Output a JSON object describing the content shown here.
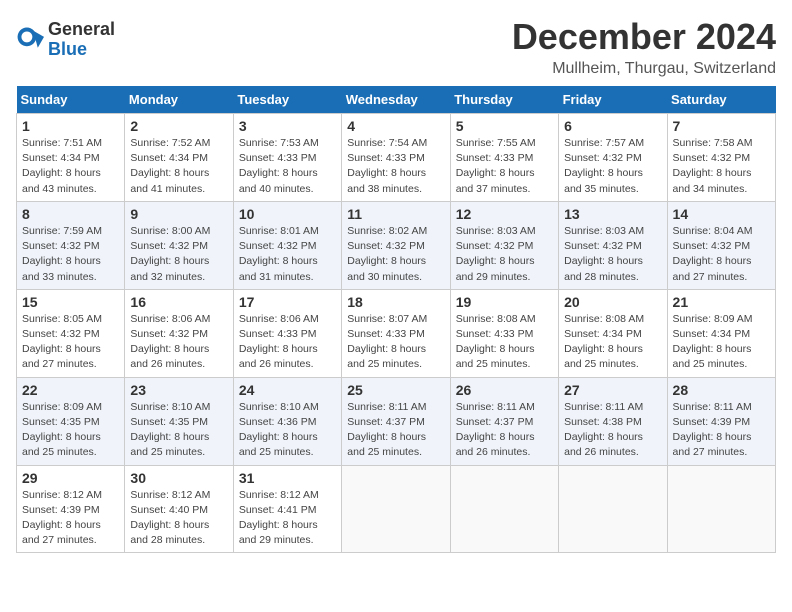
{
  "header": {
    "logo_line1": "General",
    "logo_line2": "Blue",
    "month": "December 2024",
    "location": "Mullheim, Thurgau, Switzerland"
  },
  "weekdays": [
    "Sunday",
    "Monday",
    "Tuesday",
    "Wednesday",
    "Thursday",
    "Friday",
    "Saturday"
  ],
  "weeks": [
    [
      {
        "day": "1",
        "sunrise": "7:51 AM",
        "sunset": "4:34 PM",
        "daylight": "8 hours and 43 minutes."
      },
      {
        "day": "2",
        "sunrise": "7:52 AM",
        "sunset": "4:34 PM",
        "daylight": "8 hours and 41 minutes."
      },
      {
        "day": "3",
        "sunrise": "7:53 AM",
        "sunset": "4:33 PM",
        "daylight": "8 hours and 40 minutes."
      },
      {
        "day": "4",
        "sunrise": "7:54 AM",
        "sunset": "4:33 PM",
        "daylight": "8 hours and 38 minutes."
      },
      {
        "day": "5",
        "sunrise": "7:55 AM",
        "sunset": "4:33 PM",
        "daylight": "8 hours and 37 minutes."
      },
      {
        "day": "6",
        "sunrise": "7:57 AM",
        "sunset": "4:32 PM",
        "daylight": "8 hours and 35 minutes."
      },
      {
        "day": "7",
        "sunrise": "7:58 AM",
        "sunset": "4:32 PM",
        "daylight": "8 hours and 34 minutes."
      }
    ],
    [
      {
        "day": "8",
        "sunrise": "7:59 AM",
        "sunset": "4:32 PM",
        "daylight": "8 hours and 33 minutes."
      },
      {
        "day": "9",
        "sunrise": "8:00 AM",
        "sunset": "4:32 PM",
        "daylight": "8 hours and 32 minutes."
      },
      {
        "day": "10",
        "sunrise": "8:01 AM",
        "sunset": "4:32 PM",
        "daylight": "8 hours and 31 minutes."
      },
      {
        "day": "11",
        "sunrise": "8:02 AM",
        "sunset": "4:32 PM",
        "daylight": "8 hours and 30 minutes."
      },
      {
        "day": "12",
        "sunrise": "8:03 AM",
        "sunset": "4:32 PM",
        "daylight": "8 hours and 29 minutes."
      },
      {
        "day": "13",
        "sunrise": "8:03 AM",
        "sunset": "4:32 PM",
        "daylight": "8 hours and 28 minutes."
      },
      {
        "day": "14",
        "sunrise": "8:04 AM",
        "sunset": "4:32 PM",
        "daylight": "8 hours and 27 minutes."
      }
    ],
    [
      {
        "day": "15",
        "sunrise": "8:05 AM",
        "sunset": "4:32 PM",
        "daylight": "8 hours and 27 minutes."
      },
      {
        "day": "16",
        "sunrise": "8:06 AM",
        "sunset": "4:32 PM",
        "daylight": "8 hours and 26 minutes."
      },
      {
        "day": "17",
        "sunrise": "8:06 AM",
        "sunset": "4:33 PM",
        "daylight": "8 hours and 26 minutes."
      },
      {
        "day": "18",
        "sunrise": "8:07 AM",
        "sunset": "4:33 PM",
        "daylight": "8 hours and 25 minutes."
      },
      {
        "day": "19",
        "sunrise": "8:08 AM",
        "sunset": "4:33 PM",
        "daylight": "8 hours and 25 minutes."
      },
      {
        "day": "20",
        "sunrise": "8:08 AM",
        "sunset": "4:34 PM",
        "daylight": "8 hours and 25 minutes."
      },
      {
        "day": "21",
        "sunrise": "8:09 AM",
        "sunset": "4:34 PM",
        "daylight": "8 hours and 25 minutes."
      }
    ],
    [
      {
        "day": "22",
        "sunrise": "8:09 AM",
        "sunset": "4:35 PM",
        "daylight": "8 hours and 25 minutes."
      },
      {
        "day": "23",
        "sunrise": "8:10 AM",
        "sunset": "4:35 PM",
        "daylight": "8 hours and 25 minutes."
      },
      {
        "day": "24",
        "sunrise": "8:10 AM",
        "sunset": "4:36 PM",
        "daylight": "8 hours and 25 minutes."
      },
      {
        "day": "25",
        "sunrise": "8:11 AM",
        "sunset": "4:37 PM",
        "daylight": "8 hours and 25 minutes."
      },
      {
        "day": "26",
        "sunrise": "8:11 AM",
        "sunset": "4:37 PM",
        "daylight": "8 hours and 26 minutes."
      },
      {
        "day": "27",
        "sunrise": "8:11 AM",
        "sunset": "4:38 PM",
        "daylight": "8 hours and 26 minutes."
      },
      {
        "day": "28",
        "sunrise": "8:11 AM",
        "sunset": "4:39 PM",
        "daylight": "8 hours and 27 minutes."
      }
    ],
    [
      {
        "day": "29",
        "sunrise": "8:12 AM",
        "sunset": "4:39 PM",
        "daylight": "8 hours and 27 minutes."
      },
      {
        "day": "30",
        "sunrise": "8:12 AM",
        "sunset": "4:40 PM",
        "daylight": "8 hours and 28 minutes."
      },
      {
        "day": "31",
        "sunrise": "8:12 AM",
        "sunset": "4:41 PM",
        "daylight": "8 hours and 29 minutes."
      },
      null,
      null,
      null,
      null
    ]
  ]
}
